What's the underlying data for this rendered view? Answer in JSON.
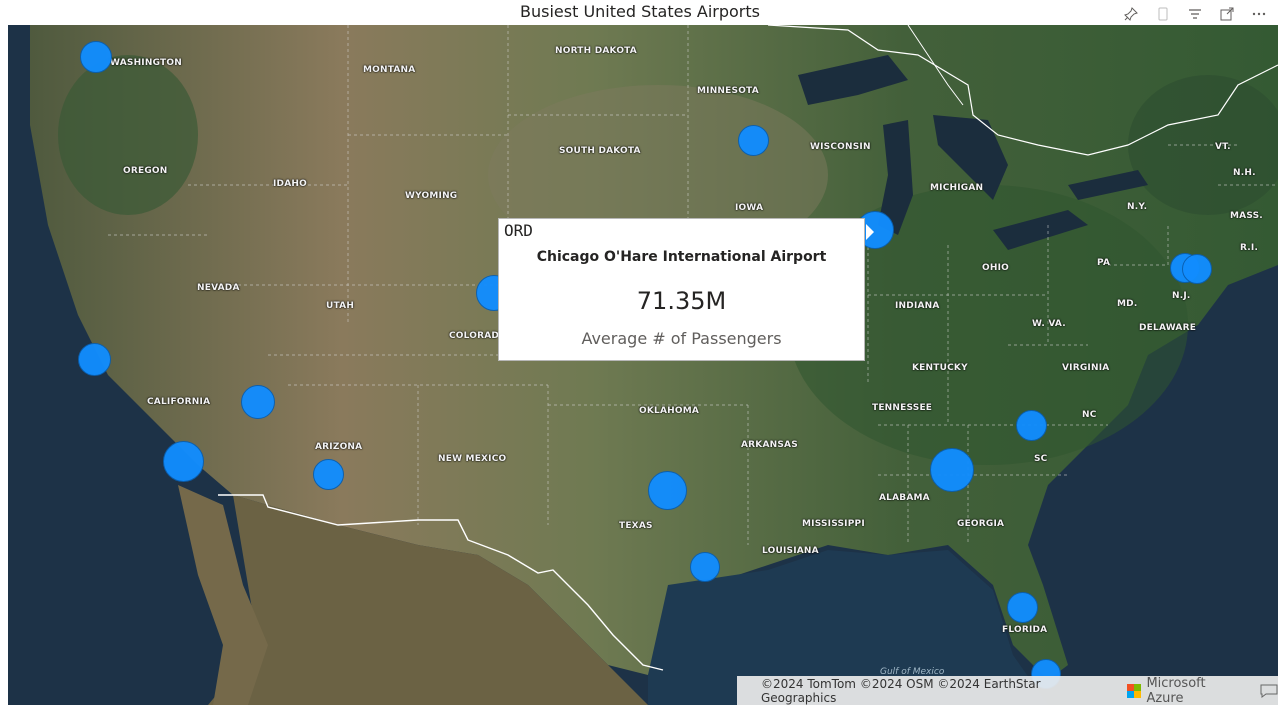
{
  "visual": {
    "title": "Busiest United States Airports"
  },
  "toolbar": {
    "icons": [
      "pin-icon",
      "copy-icon",
      "filter-icon",
      "focus-mode-icon",
      "more-options-icon"
    ]
  },
  "map": {
    "state_labels": {
      "washington": "WASHINGTON",
      "montana": "MONTANA",
      "north_dakota": "NORTH DAKOTA",
      "minnesota": "MINNESOTA",
      "south_dakota": "SOUTH DAKOTA",
      "wisconsin": "WISCONSIN",
      "oregon": "OREGON",
      "idaho": "IDAHO",
      "wyoming": "WYOMING",
      "iowa": "IOWA",
      "michigan": "MICHIGAN",
      "vt": "VT.",
      "nh": "N.H.",
      "ny": "N.Y.",
      "mass": "MASS.",
      "ri": "R.I.",
      "ohio": "OHIO",
      "pa": "PA",
      "nj": "N.J.",
      "md": "MD.",
      "delaware": "DELAWARE",
      "nevada": "NEVADA",
      "utah": "UTAH",
      "colorado": "COLORADO",
      "indiana": "INDIANA",
      "wva": "W. VA.",
      "kentucky": "KENTUCKY",
      "virginia": "VIRGINIA",
      "california": "CALIFORNIA",
      "oklahoma": "OKLAHOMA",
      "tennessee": "TENNESSEE",
      "nc": "NC",
      "arizona": "ARIZONA",
      "new_mexico": "NEW MEXICO",
      "arkansas": "ARKANSAS",
      "sc": "SC",
      "alabama": "ALABAMA",
      "texas": "TEXAS",
      "mississippi": "MISSISSIPPI",
      "georgia": "GEORGIA",
      "louisiana": "LOUISIANA",
      "florida": "FLORIDA",
      "gulf": "Gulf of Mexico"
    },
    "bubble_color": "#118dff"
  },
  "tooltip": {
    "code": "ORD",
    "airport_name": "Chicago O'Hare International Airport",
    "value": "71.35M",
    "measure": "Average # of Passengers"
  },
  "attribution": {
    "text": "©2024 TomTom ©2024 OSM ©2024 EarthStar Geographics",
    "provider": "Microsoft Azure"
  }
}
